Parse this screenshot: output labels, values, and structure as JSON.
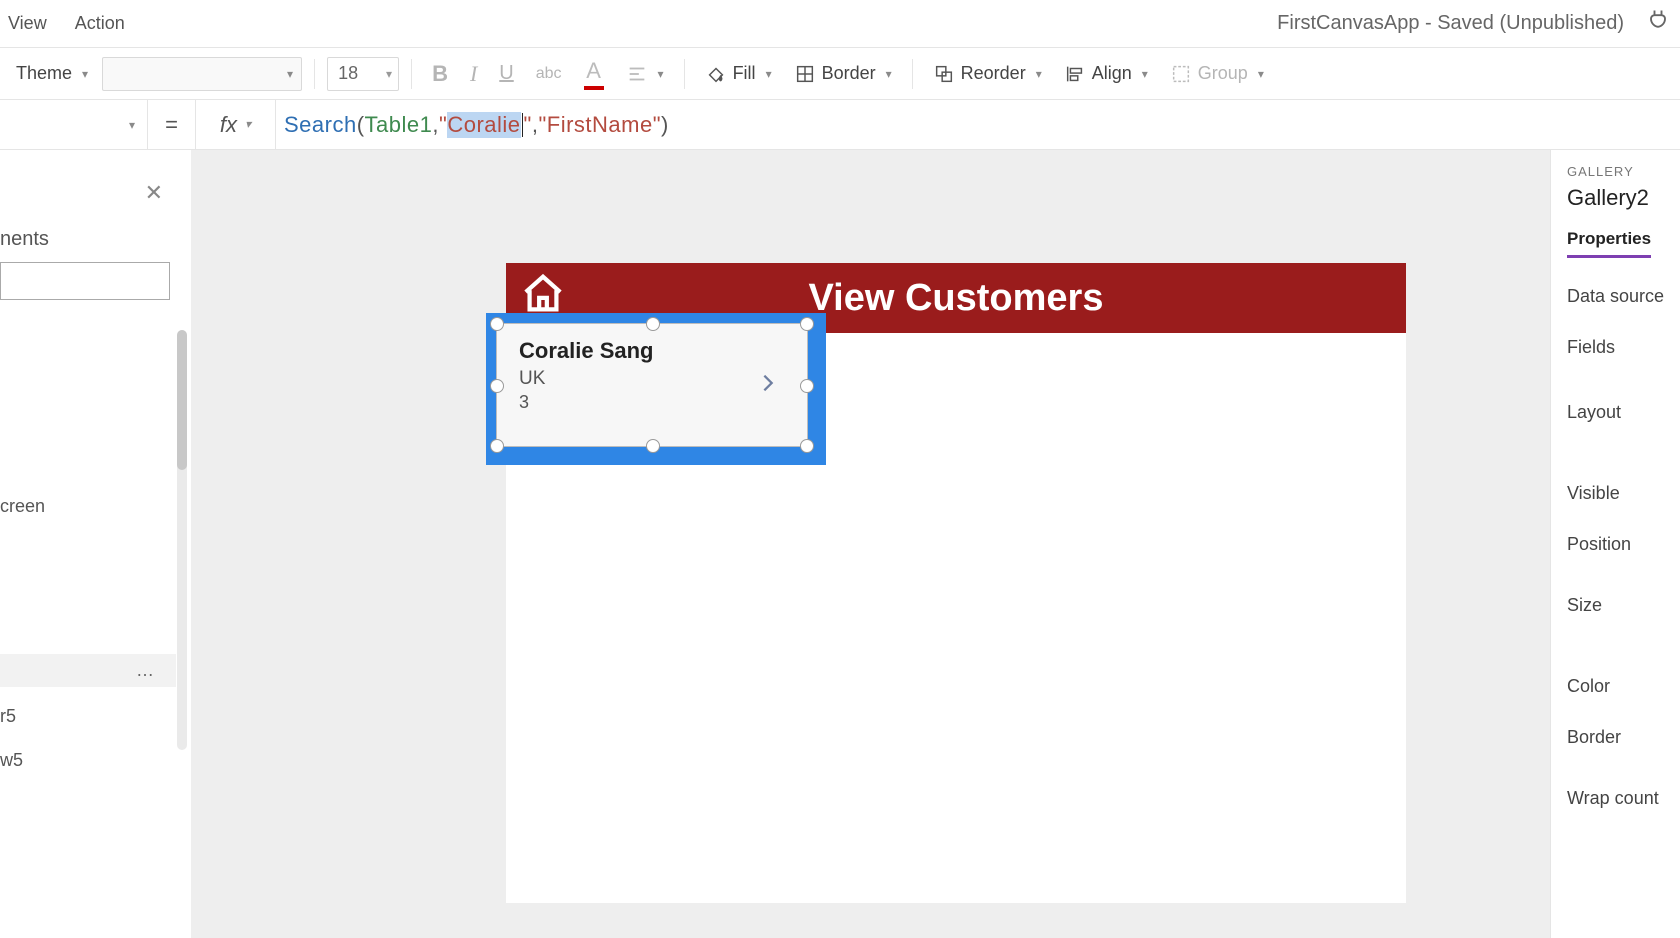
{
  "menubar": {
    "items": [
      "View",
      "Action"
    ],
    "app_status": "FirstCanvasApp - Saved (Unpublished)"
  },
  "ribbon": {
    "theme_label": "Theme",
    "font_name": "",
    "font_size": "18",
    "fill_label": "Fill",
    "border_label": "Border",
    "reorder_label": "Reorder",
    "align_label": "Align",
    "group_label": "Group"
  },
  "formula_bar": {
    "equals": "=",
    "fx_label": "fx",
    "formula": {
      "fn": "Search",
      "open": "(",
      "datasource": "Table1",
      "comma1": ", ",
      "q1": "\"",
      "selected_text": "Coralie",
      "q2": "\"",
      "comma2": ", ",
      "q3": "\"",
      "column": "FirstName",
      "q4": "\"",
      "close": ")"
    }
  },
  "left_panel": {
    "heading_fragment": "nents",
    "item_screen": "creen",
    "item_r5": "r5",
    "item_w5": "w5",
    "more": "…"
  },
  "canvas": {
    "header_title": "View Customers",
    "gallery_item": {
      "name": "Coralie  Sang",
      "subtitle": "UK",
      "number": "3"
    }
  },
  "right_panel": {
    "category": "GALLERY",
    "name": "Gallery2",
    "tab_properties": "Properties",
    "rows": [
      "Data source",
      "Fields",
      "Layout",
      "Visible",
      "Position",
      "Size",
      "Color",
      "Border",
      "Wrap count"
    ]
  }
}
